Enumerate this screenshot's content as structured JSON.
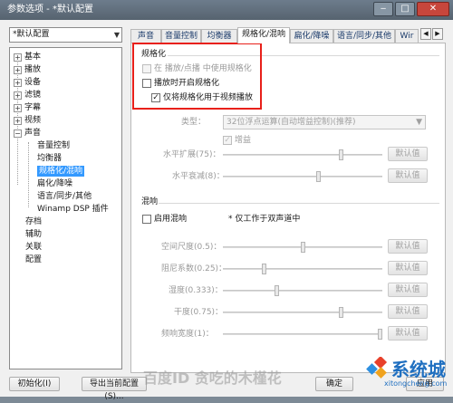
{
  "window": {
    "title": "参数选项 - *默认配置"
  },
  "profile": {
    "selected": "*默认配置"
  },
  "tree": [
    "基本",
    "播放",
    "设备",
    "滤镜",
    "字幕",
    "视频",
    "声音",
    "音量控制",
    "均衡器",
    "规格化/混响",
    "扁化/降噪",
    "语言/同步/其他",
    "Winamp DSP 插件",
    "存档",
    "辅助",
    "关联",
    "配置"
  ],
  "tabs": [
    "声音",
    "音量控制",
    "均衡器",
    "规格化/混响",
    "扁化/降噪",
    "语言/同步/其他",
    "Wir"
  ],
  "norm": {
    "header": "规格化",
    "opt1": "在 播放/点播 中使用规格化",
    "opt2": "播放时开启规格化",
    "opt3": "仅将规格化用于视频播放"
  },
  "type": {
    "label": "类型：",
    "value": "32位浮点运算(自动增益控制)(推荐)"
  },
  "gain": {
    "label": "增益"
  },
  "h_expand": {
    "label": "水平扩展(75)：",
    "level": 0.75
  },
  "h_decay": {
    "label": "水平衰减(8)：",
    "level": 0.6
  },
  "reverb": {
    "header": "混响",
    "enable": "启用混响",
    "note": "* 仅工作于双声道中",
    "rows": [
      {
        "label": "空间尺度(0.5)：",
        "level": 0.5
      },
      {
        "label": "阻尼系数(0.25)：",
        "level": 0.25
      },
      {
        "label": "湿度(0.333)：",
        "level": 0.333
      },
      {
        "label": "干度(0.75)：",
        "level": 0.75
      },
      {
        "label": "频响宽度(1)：",
        "level": 1.0
      }
    ]
  },
  "default_btn": "默认值",
  "bottom": {
    "init": "初始化(I)",
    "export": "导出当前配置(S)...",
    "ok": "确定",
    "apply": "应用"
  },
  "watermark": {
    "text": "百度ID 贪吃的木槿花",
    "brand": "系统城",
    "url": "xitongcheng.com"
  },
  "colors": {
    "selection": "#3399ff",
    "highlight": "#e8201a",
    "brand": "#1f6fc0"
  }
}
